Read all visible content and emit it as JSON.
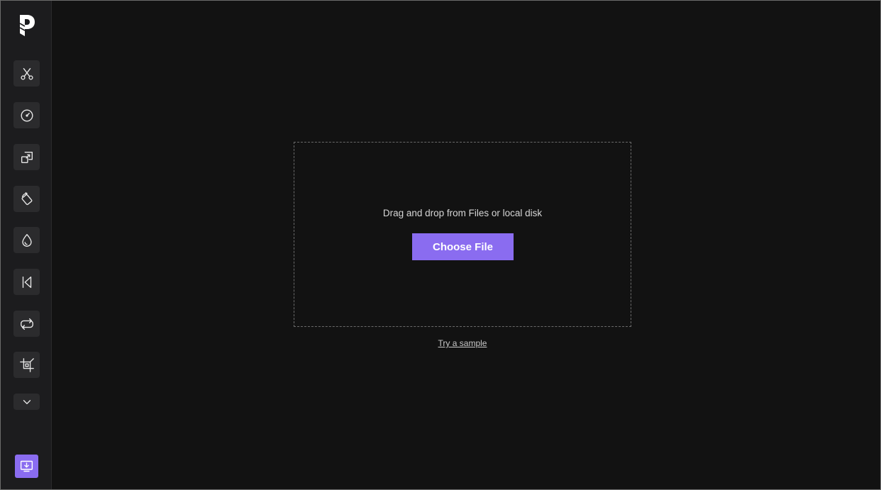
{
  "sidebar": {
    "logo_icon": "brand-logo-icon",
    "tools": [
      {
        "icon": "scissors-icon"
      },
      {
        "icon": "speedometer-icon"
      },
      {
        "icon": "resize-icon"
      },
      {
        "icon": "rotate-icon"
      },
      {
        "icon": "color-drop-icon"
      },
      {
        "icon": "reverse-icon"
      },
      {
        "icon": "loop-icon"
      },
      {
        "icon": "crop-icon"
      }
    ],
    "more_icon": "chevron-down-icon",
    "export_icon": "download-screen-icon"
  },
  "upload": {
    "instruction": "Drag and drop from Files or local disk",
    "choose_label": "Choose File",
    "sample_label": "Try a sample"
  },
  "colors": {
    "accent": "#8a6cf0",
    "background": "#121212",
    "sidebar": "#1c1c1e",
    "tool_button": "#2b2b2d"
  }
}
